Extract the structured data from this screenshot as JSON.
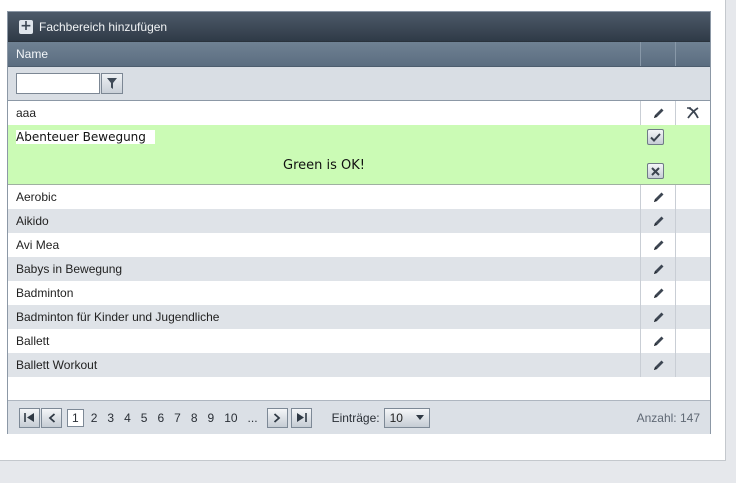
{
  "toolbar": {
    "add_label": "Fachbereich hinzufügen"
  },
  "header": {
    "name_col": "Name"
  },
  "filter": {
    "value": "",
    "placeholder": ""
  },
  "rows_top": [
    {
      "name": "aaa"
    }
  ],
  "edit_row": {
    "value": "Abenteuer Bewegung",
    "message": "Green is OK!"
  },
  "rows": [
    {
      "name": "Aerobic"
    },
    {
      "name": "Aikido"
    },
    {
      "name": "Avi Mea"
    },
    {
      "name": "Babys in Bewegung"
    },
    {
      "name": "Badminton"
    },
    {
      "name": "Badminton für Kinder und Jugendliche"
    },
    {
      "name": "Ballett"
    },
    {
      "name": "Ballett Workout"
    }
  ],
  "pager": {
    "pages": [
      "1",
      "2",
      "3",
      "4",
      "5",
      "6",
      "7",
      "8",
      "9",
      "10",
      "..."
    ],
    "current_page": "1",
    "page_size_label": "Einträge:",
    "page_size": "10",
    "total": "Anzahl: 147"
  },
  "colors": {
    "toolbar": "#2f3a47",
    "header": "#5b6d80",
    "edit_row_bg": "#cbfbb5",
    "alt_row": "#dfe3e8"
  }
}
